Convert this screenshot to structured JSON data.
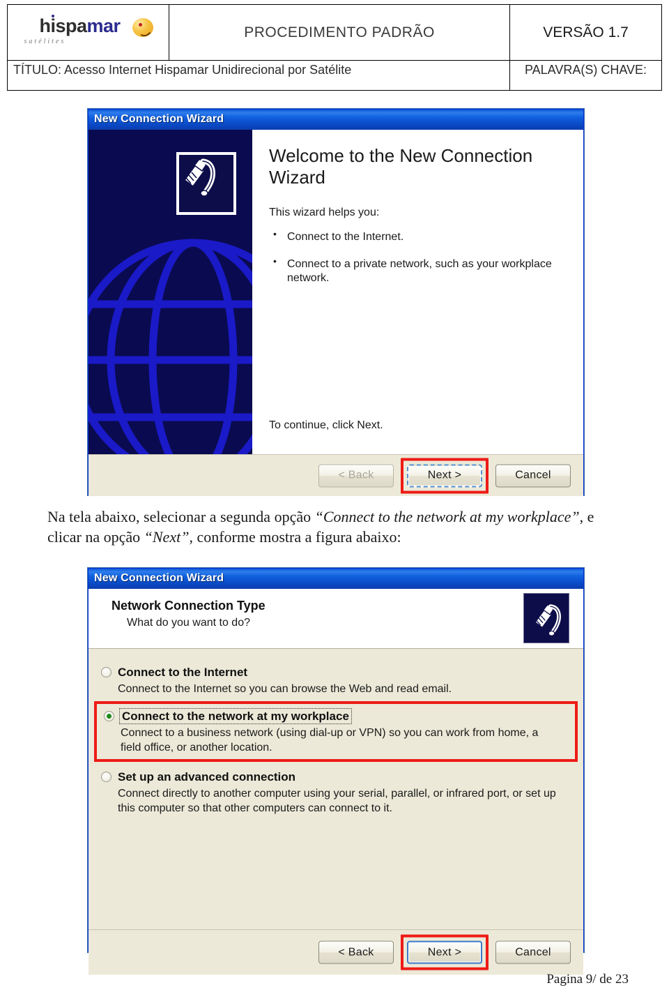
{
  "header": {
    "logo": {
      "name_part1": "hispa",
      "name_part2": "mar",
      "tagline": "satélites",
      "ball_icon": "smiley-ball-icon"
    },
    "procedure_label": "PROCEDIMENTO PADRÃO",
    "version_label": "VERSÃO 1.7",
    "title_label": "TÍTULO: Acesso Internet Hispamar Unidirecional por Satélite",
    "keywords_label": "PALAVRA(S) CHAVE:"
  },
  "dialog1": {
    "title": "New Connection Wizard",
    "heading": "Welcome to the New Connection Wizard",
    "intro": "This wizard helps you:",
    "bullets": [
      "Connect to the Internet.",
      "Connect to a private network, such as your workplace network."
    ],
    "continue_text": "To continue, click Next.",
    "icon_name": "network-plug-icon",
    "banner_graphic": "globe-graphic",
    "buttons": {
      "back": "< Back",
      "next": "Next >",
      "cancel": "Cancel",
      "back_disabled": true,
      "next_highlighted": true
    },
    "colors": {
      "titlebar_blue": "#0c52d0",
      "banner_navy": "#0a0a50",
      "banner_globe_blue": "#1a1ac8",
      "highlight_red": "#ee1b16",
      "dialog_face": "#ece9d8"
    }
  },
  "instruction": {
    "line1_a": "Na tela abaixo, selecionar a segunda opção ",
    "line1_quote": "“Connect to the network at my workplace”",
    "line1_b": ", e clicar na opção ",
    "line2_quote": "“Next”",
    "line2_b": ", conforme mostra a figura abaixo:"
  },
  "dialog2": {
    "title": "New Connection Wizard",
    "page_heading": "Network Connection Type",
    "page_subheading": "What do you want to do?",
    "icon_name": "network-plug-icon",
    "options": [
      {
        "label": "Connect to the Internet",
        "description": "Connect to the Internet so you can browse the Web and read email.",
        "selected": false,
        "highlighted": false
      },
      {
        "label": "Connect to the network at my workplace",
        "description": "Connect to a business network (using dial-up or VPN) so you can work from home, a field office, or another location.",
        "selected": true,
        "highlighted": true
      },
      {
        "label": "Set up an advanced connection",
        "description": "Connect directly to another computer using your serial, parallel, or infrared port, or set up this computer so that other computers can connect to it.",
        "selected": false,
        "highlighted": false
      }
    ],
    "buttons": {
      "back": "< Back",
      "next": "Next >",
      "cancel": "Cancel",
      "back_disabled": false,
      "next_highlighted": true
    }
  },
  "footer": {
    "page_label": "Pagina 9/ de 23"
  }
}
